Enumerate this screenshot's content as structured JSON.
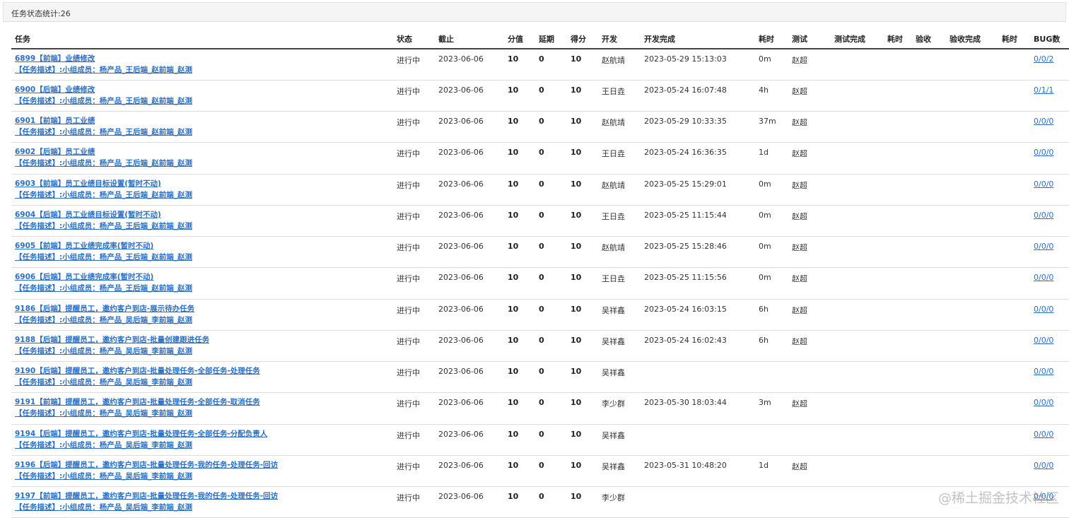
{
  "header": {
    "title": "任务状态统计:26"
  },
  "columns": [
    "任务",
    "状态",
    "截止",
    "分值",
    "延期",
    "得分",
    "开发",
    "开发完成",
    "耗时",
    "测试",
    "测试完成",
    "耗时",
    "验收",
    "验收完成",
    "耗时",
    "BUG数"
  ],
  "rows": [
    {
      "title": "6899【前端】业绩修改",
      "desc": "【任务描述】:小组成员：杨产品_王后端_赵前端_赵测",
      "status": "进行中",
      "due": "2023-06-06",
      "score": "10",
      "delay": "0",
      "points": "10",
      "dev": "赵航靖",
      "dev_done": "2023-05-29 15:13:03",
      "dev_time": "0m",
      "tester": "赵超",
      "test_done": "",
      "test_time": "",
      "accept": "",
      "accept_done": "",
      "accept_time": "",
      "bugs": "0/0/2"
    },
    {
      "title": "6900【后端】业绩修改",
      "desc": "【任务描述】:小组成员：杨产品_王后端_赵前端_赵测",
      "status": "进行中",
      "due": "2023-06-06",
      "score": "10",
      "delay": "0",
      "points": "10",
      "dev": "王日垚",
      "dev_done": "2023-05-24 16:07:48",
      "dev_time": "4h",
      "tester": "赵超",
      "test_done": "",
      "test_time": "",
      "accept": "",
      "accept_done": "",
      "accept_time": "",
      "bugs": "0/1/1"
    },
    {
      "title": "6901【前端】员工业绩",
      "desc": "【任务描述】:小组成员：杨产品_王后端_赵前端_赵测",
      "status": "进行中",
      "due": "2023-06-06",
      "score": "10",
      "delay": "0",
      "points": "10",
      "dev": "赵航靖",
      "dev_done": "2023-05-29 10:33:35",
      "dev_time": "37m",
      "tester": "赵超",
      "test_done": "",
      "test_time": "",
      "accept": "",
      "accept_done": "",
      "accept_time": "",
      "bugs": "0/0/0"
    },
    {
      "title": "6902【后端】员工业绩",
      "desc": "【任务描述】:小组成员：杨产品_王后端_赵前端_赵测",
      "status": "进行中",
      "due": "2023-06-06",
      "score": "10",
      "delay": "0",
      "points": "10",
      "dev": "王日垚",
      "dev_done": "2023-05-24 16:36:35",
      "dev_time": "1d",
      "tester": "赵超",
      "test_done": "",
      "test_time": "",
      "accept": "",
      "accept_done": "",
      "accept_time": "",
      "bugs": "0/0/0"
    },
    {
      "title": "6903【前端】员工业绩目标设置(暂时不动)",
      "desc": "【任务描述】:小组成员：杨产品_王后端_赵前端_赵测",
      "status": "进行中",
      "due": "2023-06-06",
      "score": "10",
      "delay": "0",
      "points": "10",
      "dev": "赵航靖",
      "dev_done": "2023-05-25 15:29:01",
      "dev_time": "0m",
      "tester": "赵超",
      "test_done": "",
      "test_time": "",
      "accept": "",
      "accept_done": "",
      "accept_time": "",
      "bugs": "0/0/0"
    },
    {
      "title": "6904【后端】员工业绩目标设置(暂时不动)",
      "desc": "【任务描述】:小组成员：杨产品_王后端_赵前端_赵测",
      "status": "进行中",
      "due": "2023-06-06",
      "score": "10",
      "delay": "0",
      "points": "10",
      "dev": "王日垚",
      "dev_done": "2023-05-25 11:15:44",
      "dev_time": "0m",
      "tester": "赵超",
      "test_done": "",
      "test_time": "",
      "accept": "",
      "accept_done": "",
      "accept_time": "",
      "bugs": "0/0/0"
    },
    {
      "title": "6905【前端】员工业绩完成率(暂时不动)",
      "desc": "【任务描述】:小组成员：杨产品_王后端_赵前端_赵测",
      "status": "进行中",
      "due": "2023-06-06",
      "score": "10",
      "delay": "0",
      "points": "10",
      "dev": "赵航靖",
      "dev_done": "2023-05-25 15:28:46",
      "dev_time": "0m",
      "tester": "赵超",
      "test_done": "",
      "test_time": "",
      "accept": "",
      "accept_done": "",
      "accept_time": "",
      "bugs": "0/0/0"
    },
    {
      "title": "6906【后端】员工业绩完成率(暂时不动)",
      "desc": "【任务描述】:小组成员：杨产品_王后端_赵前端_赵测",
      "status": "进行中",
      "due": "2023-06-06",
      "score": "10",
      "delay": "0",
      "points": "10",
      "dev": "王日垚",
      "dev_done": "2023-05-25 11:15:56",
      "dev_time": "0m",
      "tester": "赵超",
      "test_done": "",
      "test_time": "",
      "accept": "",
      "accept_done": "",
      "accept_time": "",
      "bugs": "0/0/0"
    },
    {
      "title": "9186【后端】提醒员工，邀约客户到店-展示待办任务",
      "desc": "【任务描述】:小组成员：杨产品_吴后端_李前端_赵测",
      "status": "进行中",
      "due": "2023-06-06",
      "score": "10",
      "delay": "0",
      "points": "10",
      "dev": "吴祥鑫",
      "dev_done": "2023-05-24 16:03:15",
      "dev_time": "6h",
      "tester": "赵超",
      "test_done": "",
      "test_time": "",
      "accept": "",
      "accept_done": "",
      "accept_time": "",
      "bugs": "0/0/0"
    },
    {
      "title": "9188【后端】提醒员工，邀约客户到店-批量创建跟进任务",
      "desc": "【任务描述】:小组成员：杨产品_吴后端_李前端_赵测",
      "status": "进行中",
      "due": "2023-06-06",
      "score": "10",
      "delay": "0",
      "points": "10",
      "dev": "吴祥鑫",
      "dev_done": "2023-05-24 16:02:43",
      "dev_time": "6h",
      "tester": "赵超",
      "test_done": "",
      "test_time": "",
      "accept": "",
      "accept_done": "",
      "accept_time": "",
      "bugs": "0/0/0"
    },
    {
      "title": "9190【后端】提醒员工，邀约客户到店-批量处理任务-全部任务-处理任务",
      "desc": "【任务描述】:小组成员：杨产品_吴后端_李前端_赵测",
      "status": "进行中",
      "due": "2023-06-06",
      "score": "10",
      "delay": "0",
      "points": "10",
      "dev": "吴祥鑫",
      "dev_done": "",
      "dev_time": "",
      "tester": "",
      "test_done": "",
      "test_time": "",
      "accept": "",
      "accept_done": "",
      "accept_time": "",
      "bugs": "0/0/0"
    },
    {
      "title": "9191【前端】提醒员工，邀约客户到店-批量处理任务-全部任务-取消任务",
      "desc": "【任务描述】:小组成员：杨产品_吴后端_李前端_赵测",
      "status": "进行中",
      "due": "2023-06-06",
      "score": "10",
      "delay": "0",
      "points": "10",
      "dev": "李少群",
      "dev_done": "2023-05-30 18:03:44",
      "dev_time": "3m",
      "tester": "赵超",
      "test_done": "",
      "test_time": "",
      "accept": "",
      "accept_done": "",
      "accept_time": "",
      "bugs": "0/0/0"
    },
    {
      "title": "9194【后端】提醒员工，邀约客户到店-批量处理任务-全部任务-分配负责人",
      "desc": "【任务描述】:小组成员：杨产品_吴后端_李前端_赵测",
      "status": "进行中",
      "due": "2023-06-06",
      "score": "10",
      "delay": "0",
      "points": "10",
      "dev": "吴祥鑫",
      "dev_done": "",
      "dev_time": "",
      "tester": "",
      "test_done": "",
      "test_time": "",
      "accept": "",
      "accept_done": "",
      "accept_time": "",
      "bugs": "0/0/0"
    },
    {
      "title": "9196【后端】提醒员工，邀约客户到店-批量处理任务-我的任务-处理任务-回访",
      "desc": "【任务描述】:小组成员：杨产品_吴后端_李前端_赵测",
      "status": "进行中",
      "due": "2023-06-06",
      "score": "10",
      "delay": "0",
      "points": "10",
      "dev": "吴祥鑫",
      "dev_done": "2023-05-31 10:48:20",
      "dev_time": "1d",
      "tester": "赵超",
      "test_done": "",
      "test_time": "",
      "accept": "",
      "accept_done": "",
      "accept_time": "",
      "bugs": "0/0/0"
    },
    {
      "title": "9197【前端】提醒员工，邀约客户到店-批量处理任务-我的任务-处理任务-回访",
      "desc": "【任务描述】:小组成员：杨产品_吴后端_李前端_赵测",
      "status": "进行中",
      "due": "2023-06-06",
      "score": "10",
      "delay": "0",
      "points": "10",
      "dev": "李少群",
      "dev_done": "",
      "dev_time": "",
      "tester": "",
      "test_done": "",
      "test_time": "",
      "accept": "",
      "accept_done": "",
      "accept_time": "",
      "bugs": "0/0/0"
    }
  ],
  "watermark": "@稀土掘金技术社区"
}
